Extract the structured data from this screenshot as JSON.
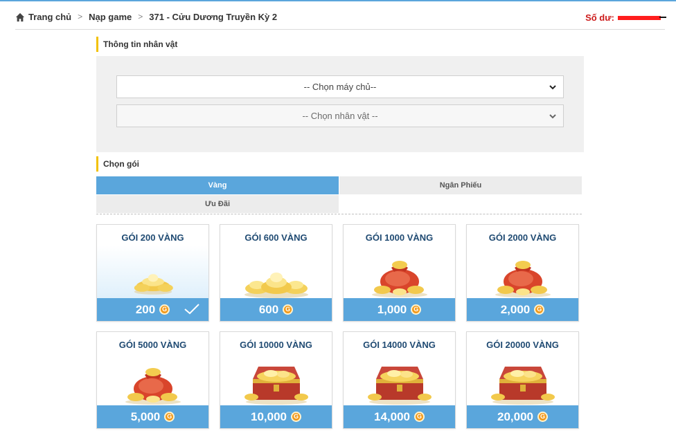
{
  "breadcrumb": {
    "items": [
      "Trang chủ",
      "Nạp game",
      "371 - Cửu Dương Truyền Kỳ 2"
    ],
    "icon": "home-icon"
  },
  "balance": {
    "label": "Số dư:"
  },
  "info_section": {
    "title": "Thông tin nhân vật",
    "server_select": {
      "value": "-- Chọn máy chủ--"
    },
    "character_select": {
      "value": "-- Chọn nhân vật --"
    }
  },
  "package_section": {
    "title": "Chọn gói",
    "tabs": [
      "Vàng",
      "Ngân Phiếu",
      "Ưu Đãi"
    ],
    "active_tab": "Vàng"
  },
  "packages": [
    {
      "title": "GÓI 200 VÀNG",
      "price": "200",
      "image": "gold-ingots-small",
      "selected": true
    },
    {
      "title": "GÓI 600 VÀNG",
      "price": "600",
      "image": "gold-ingots-pile"
    },
    {
      "title": "GÓI 1000 VÀNG",
      "price": "1,000",
      "image": "gold-bag"
    },
    {
      "title": "GÓI 2000 VÀNG",
      "price": "2,000",
      "image": "gold-bag"
    },
    {
      "title": "GÓI 5000 VÀNG",
      "price": "5,000",
      "image": "gold-bag-large"
    },
    {
      "title": "GÓI 10000 VÀNG",
      "price": "10,000",
      "image": "treasure-chest"
    },
    {
      "title": "GÓI 14000 VÀNG",
      "price": "14,000",
      "image": "treasure-chest"
    },
    {
      "title": "GÓI 20000 VÀNG",
      "price": "20,000",
      "image": "treasure-chest"
    }
  ],
  "currency_icon": {
    "label": "G",
    "color": "#f29a1b"
  },
  "colors": {
    "accent": "#5aa6dc",
    "title_blue": "#1f4a72",
    "balance_red": "#cc1a1a",
    "section_bar": "#f2c100"
  }
}
